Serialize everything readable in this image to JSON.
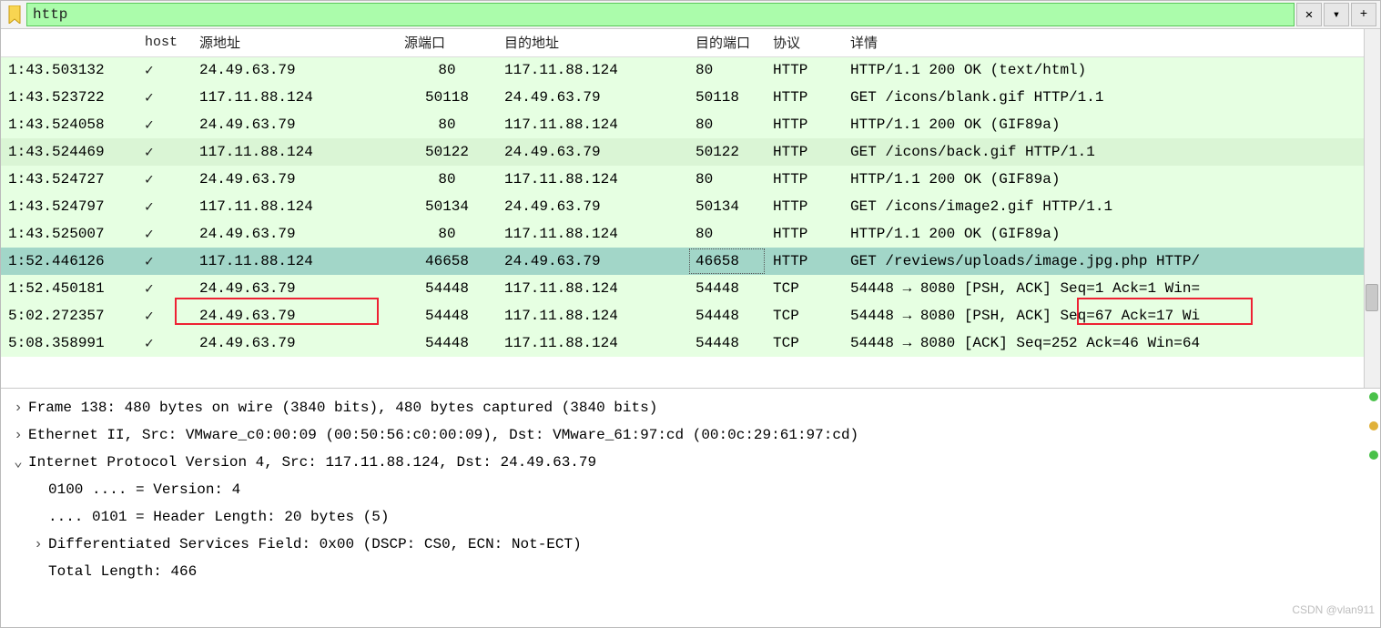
{
  "filter": {
    "value": "http"
  },
  "headers": {
    "time": "",
    "host": "host",
    "src": "源地址",
    "sport": "源端口",
    "dst": "目的地址",
    "dport": "目的端口",
    "proto": "协议",
    "info": "详情"
  },
  "rows": [
    {
      "time": "1:43.503132",
      "host": "✓",
      "src": "24.49.63.79",
      "sport": "80",
      "dst": "117.11.88.124",
      "dport": "80",
      "proto": "HTTP",
      "info": "HTTP/1.1 200 OK  (text/html)",
      "cls": "row-green"
    },
    {
      "time": "1:43.523722",
      "host": "✓",
      "src": "117.11.88.124",
      "sport": "50118",
      "dst": "24.49.63.79",
      "dport": "50118",
      "proto": "HTTP",
      "info": "GET /icons/blank.gif HTTP/1.1",
      "cls": "row-green"
    },
    {
      "time": "1:43.524058",
      "host": "✓",
      "src": "24.49.63.79",
      "sport": "80",
      "dst": "117.11.88.124",
      "dport": "80",
      "proto": "HTTP",
      "info": "HTTP/1.1 200 OK  (GIF89a)",
      "cls": "row-green"
    },
    {
      "time": "1:43.524469",
      "host": "✓",
      "src": "117.11.88.124",
      "sport": "50122",
      "dst": "24.49.63.79",
      "dport": "50122",
      "proto": "HTTP",
      "info": "GET /icons/back.gif HTTP/1.1",
      "cls": "row-green2"
    },
    {
      "time": "1:43.524727",
      "host": "✓",
      "src": "24.49.63.79",
      "sport": "80",
      "dst": "117.11.88.124",
      "dport": "80",
      "proto": "HTTP",
      "info": "HTTP/1.1 200 OK  (GIF89a)",
      "cls": "row-green"
    },
    {
      "time": "1:43.524797",
      "host": "✓",
      "src": "117.11.88.124",
      "sport": "50134",
      "dst": "24.49.63.79",
      "dport": "50134",
      "proto": "HTTP",
      "info": "GET /icons/image2.gif HTTP/1.1",
      "cls": "row-green"
    },
    {
      "time": "1:43.525007",
      "host": "✓",
      "src": "24.49.63.79",
      "sport": "80",
      "dst": "117.11.88.124",
      "dport": "80",
      "proto": "HTTP",
      "info": "HTTP/1.1 200 OK  (GIF89a)",
      "cls": "row-green"
    },
    {
      "time": "1:52.446126",
      "host": "✓",
      "src": "117.11.88.124",
      "sport": "46658",
      "dst": "24.49.63.79",
      "dport": "46658",
      "proto": "HTTP",
      "info": "GET /reviews/uploads/image.jpg.php HTTP/",
      "cls": "row-sel",
      "dportDotted": true
    },
    {
      "time": "1:52.450181",
      "host": "✓",
      "src": "24.49.63.79",
      "sport": "54448",
      "dst": "117.11.88.124",
      "dport": "54448",
      "proto": "TCP",
      "info": "54448 → 8080 [PSH, ACK] Seq=1 Ack=1 Win=",
      "cls": "row-green"
    },
    {
      "time": "5:02.272357",
      "host": "✓",
      "src": "24.49.63.79",
      "sport": "54448",
      "dst": "117.11.88.124",
      "dport": "54448",
      "proto": "TCP",
      "info": "54448 → 8080 [PSH, ACK] Seq=67 Ack=17 Wi",
      "cls": "row-green"
    },
    {
      "time": "5:08.358991",
      "host": "✓",
      "src": "24.49.63.79",
      "sport": "54448",
      "dst": "117.11.88.124",
      "dport": "54448",
      "proto": "TCP",
      "info": "54448 → 8080 [ACK] Seq=252 Ack=46 Win=64",
      "cls": "row-green"
    }
  ],
  "details": {
    "frame": "Frame 138: 480 bytes on wire (3840 bits), 480 bytes captured (3840 bits)",
    "eth": "Ethernet II, Src: VMware_c0:00:09 (00:50:56:c0:00:09), Dst: VMware_61:97:cd (00:0c:29:61:97:cd)",
    "ip": "Internet Protocol Version 4, Src: 117.11.88.124, Dst: 24.49.63.79",
    "ip_ver": "0100 .... = Version: 4",
    "ip_hl": ".... 0101 = Header Length: 20 bytes (5)",
    "ip_dsf": "Differentiated Services Field: 0x00 (DSCP: CS0, ECN: Not-ECT)",
    "ip_tl": "Total Length: 466"
  },
  "watermark": "CSDN @vlan911",
  "toolbar": {
    "clear": "✕",
    "history": "▾",
    "add": "+"
  }
}
